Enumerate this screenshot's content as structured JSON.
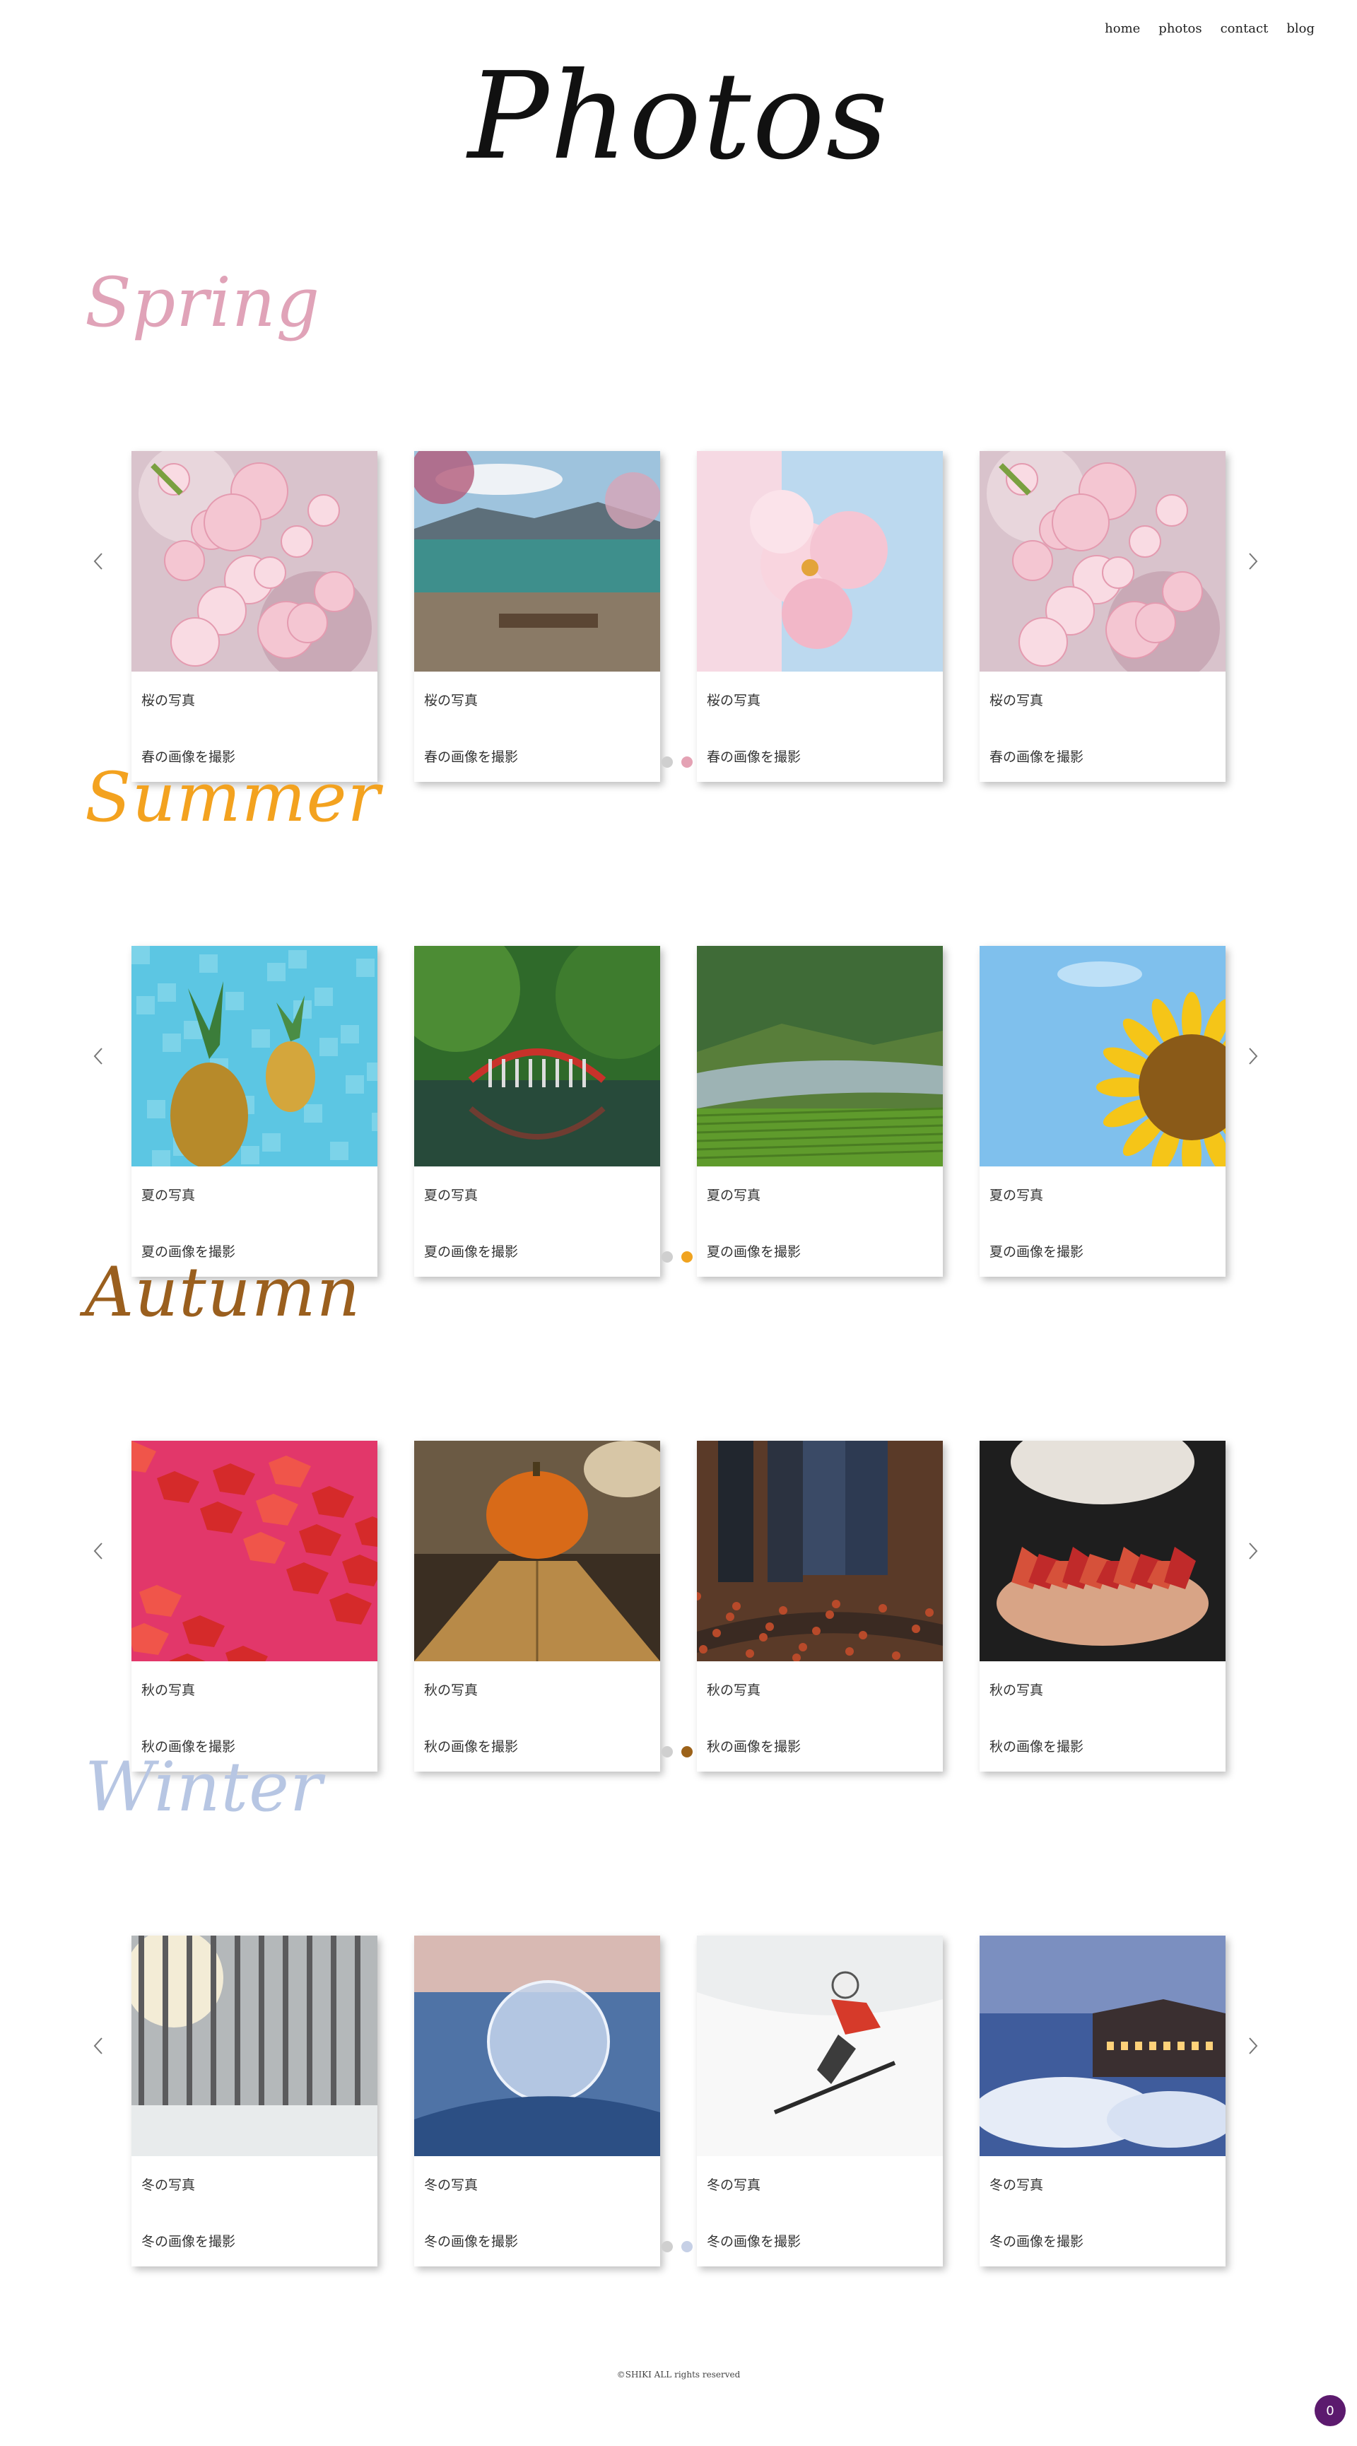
{
  "nav": {
    "home": "home",
    "photos": "photos",
    "contact": "contact",
    "blog": "blog"
  },
  "page_title": "Photos",
  "seasons": [
    {
      "title": "Spring",
      "color": "#e0a3b8",
      "active_dot": 1,
      "accent": "#e4a2b4",
      "cards": [
        {
          "title": "桜の写真",
          "subtitle": "春の画像を撮影",
          "image": "cherry-blossom"
        },
        {
          "title": "桜の写真",
          "subtitle": "春の画像を撮影",
          "image": "lakeside-cherry"
        },
        {
          "title": "桜の写真",
          "subtitle": "春の画像を撮影",
          "image": "cherry-flower-closeup"
        },
        {
          "title": "桜の写真",
          "subtitle": "春の画像を撮影",
          "image": "cherry-blossom"
        }
      ]
    },
    {
      "title": "Summer",
      "color": "#f3a21f",
      "active_dot": 1,
      "accent": "#f0a320",
      "cards": [
        {
          "title": "夏の写真",
          "subtitle": "夏の画像を撮影",
          "image": "pineapples-pool"
        },
        {
          "title": "夏の写真",
          "subtitle": "夏の画像を撮影",
          "image": "red-bridge"
        },
        {
          "title": "夏の写真",
          "subtitle": "夏の画像を撮影",
          "image": "river-valley"
        },
        {
          "title": "夏の写真",
          "subtitle": "夏の画像を撮影",
          "image": "sunflower"
        }
      ]
    },
    {
      "title": "Autumn",
      "color": "#9a5f1e",
      "active_dot": 1,
      "accent": "#9c6219",
      "cards": [
        {
          "title": "秋の写真",
          "subtitle": "秋の画像を撮影",
          "image": "red-maple"
        },
        {
          "title": "秋の写真",
          "subtitle": "秋の画像を撮影",
          "image": "pumpkin"
        },
        {
          "title": "秋の写真",
          "subtitle": "秋の画像を撮影",
          "image": "autumn-boots"
        },
        {
          "title": "秋の写真",
          "subtitle": "秋の画像を撮影",
          "image": "leaves-in-hands"
        }
      ]
    },
    {
      "title": "Winter",
      "color": "#b7c6e3",
      "active_dot": 1,
      "accent": "#c6d0e6",
      "cards": [
        {
          "title": "冬の写真",
          "subtitle": "冬の画像を撮影",
          "image": "snowy-forest"
        },
        {
          "title": "冬の写真",
          "subtitle": "冬の画像を撮影",
          "image": "frozen-bubble"
        },
        {
          "title": "冬の写真",
          "subtitle": "冬の画像を撮影",
          "image": "skier"
        },
        {
          "title": "冬の写真",
          "subtitle": "冬の画像を撮影",
          "image": "snow-village"
        }
      ]
    }
  ],
  "footer": "©SHIKI ALL rights reserved",
  "fab": "0"
}
